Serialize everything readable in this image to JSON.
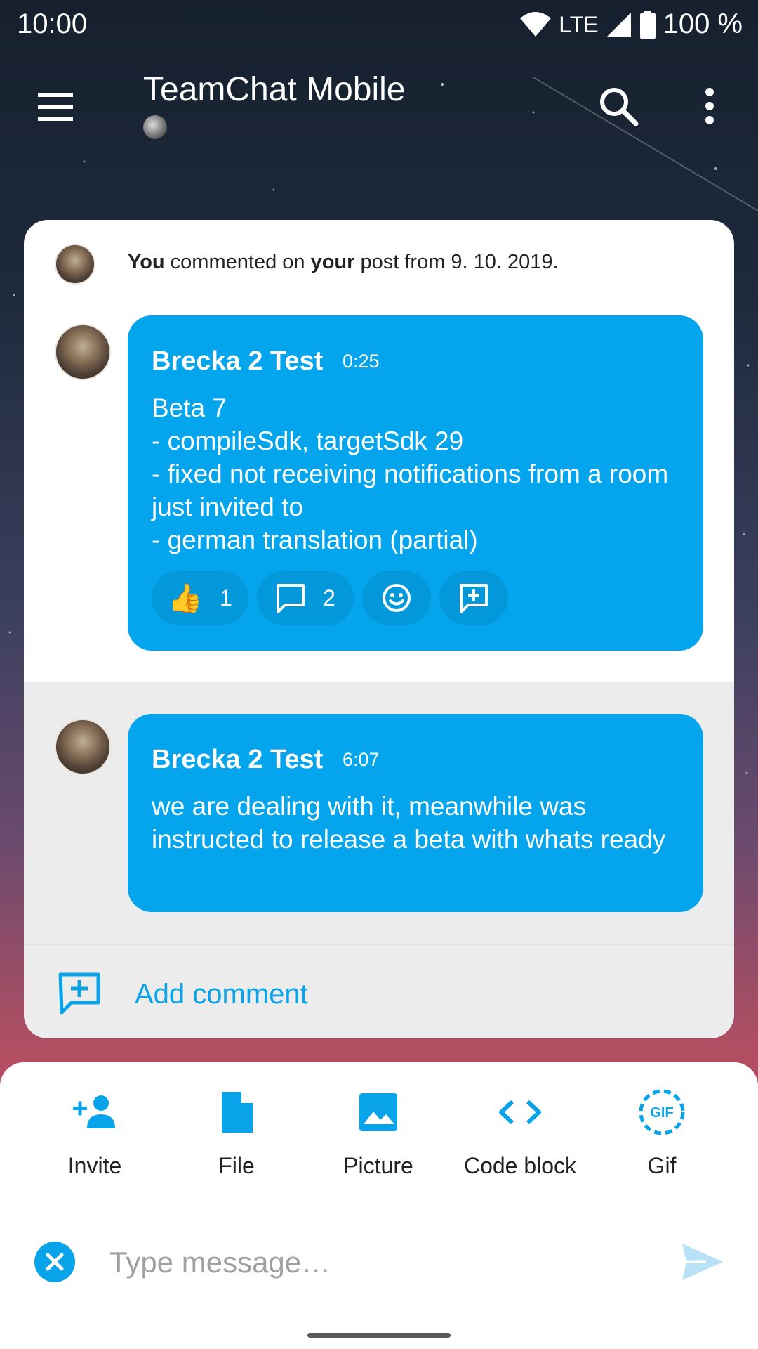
{
  "status_bar": {
    "time": "10:00",
    "network": "LTE",
    "battery": "100 %",
    "icons": [
      "wifi-icon",
      "signal-icon",
      "battery-icon"
    ]
  },
  "app_bar": {
    "title": "TeamChat Mobile",
    "icons": [
      "menu-icon",
      "search-icon",
      "more-vert-icon"
    ]
  },
  "thread": {
    "notice": {
      "actor": "You",
      "text_mid": " commented on ",
      "owner": "your",
      "text_end": " post from 9. 10. 2019."
    },
    "root_message": {
      "author": "Brecka 2 Test",
      "time": "0:25",
      "body": "Beta 7\n- compileSdk, targetSdk 29\n- fixed not receiving notifications from a room just invited to\n- german translation (partial)",
      "reactions": [
        {
          "icon": "thumbs-up-icon",
          "emoji": "👍",
          "count": "1"
        },
        {
          "icon": "comment-icon",
          "count": "2"
        },
        {
          "icon": "add-emoji-icon"
        },
        {
          "icon": "add-comment-icon"
        }
      ]
    },
    "reply": {
      "author": "Brecka 2 Test",
      "time": "6:07",
      "body": "we are dealing with it, meanwhile was instructed to release a beta with whats ready"
    },
    "add_comment_label": "Add comment"
  },
  "composer": {
    "tools": [
      {
        "label": "Invite",
        "icon": "invite-person-icon"
      },
      {
        "label": "File",
        "icon": "file-icon"
      },
      {
        "label": "Picture",
        "icon": "picture-icon"
      },
      {
        "label": "Code block",
        "icon": "code-icon"
      },
      {
        "label": "Gif",
        "icon": "gif-icon"
      }
    ],
    "placeholder": "Type message…"
  },
  "colors": {
    "accent": "#04a5ec",
    "accent_text": "#08a3e8"
  }
}
